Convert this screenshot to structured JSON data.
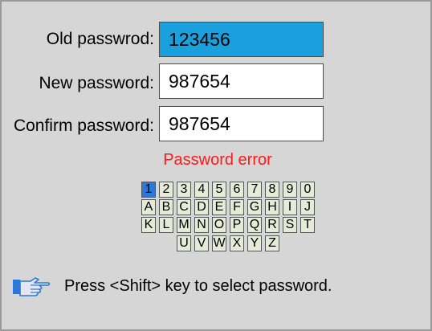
{
  "form": {
    "old_label": "Old passwrod:",
    "old_value": "123456",
    "new_label": "New password:",
    "new_value": "987654",
    "confirm_label": "Confirm password:",
    "confirm_value": "987654",
    "error_text": "Password error"
  },
  "keyboard": {
    "selected_key": "1",
    "rows": [
      [
        "1",
        "2",
        "3",
        "4",
        "5",
        "6",
        "7",
        "8",
        "9",
        "0"
      ],
      [
        "A",
        "B",
        "C",
        "D",
        "E",
        "F",
        "G",
        "H",
        "I",
        "J"
      ],
      [
        "K",
        "L",
        "M",
        "N",
        "O",
        "P",
        "Q",
        "R",
        "S",
        "T"
      ],
      [
        "U",
        "V",
        "W",
        "X",
        "Y",
        "Z"
      ]
    ]
  },
  "hint": {
    "icon": "pointing-hand-icon",
    "text": "Press <Shift> key to select password."
  },
  "colors": {
    "active_field": "#1aa0dd",
    "selected_key": "#2a79d8",
    "error": "#ff1a1a"
  }
}
